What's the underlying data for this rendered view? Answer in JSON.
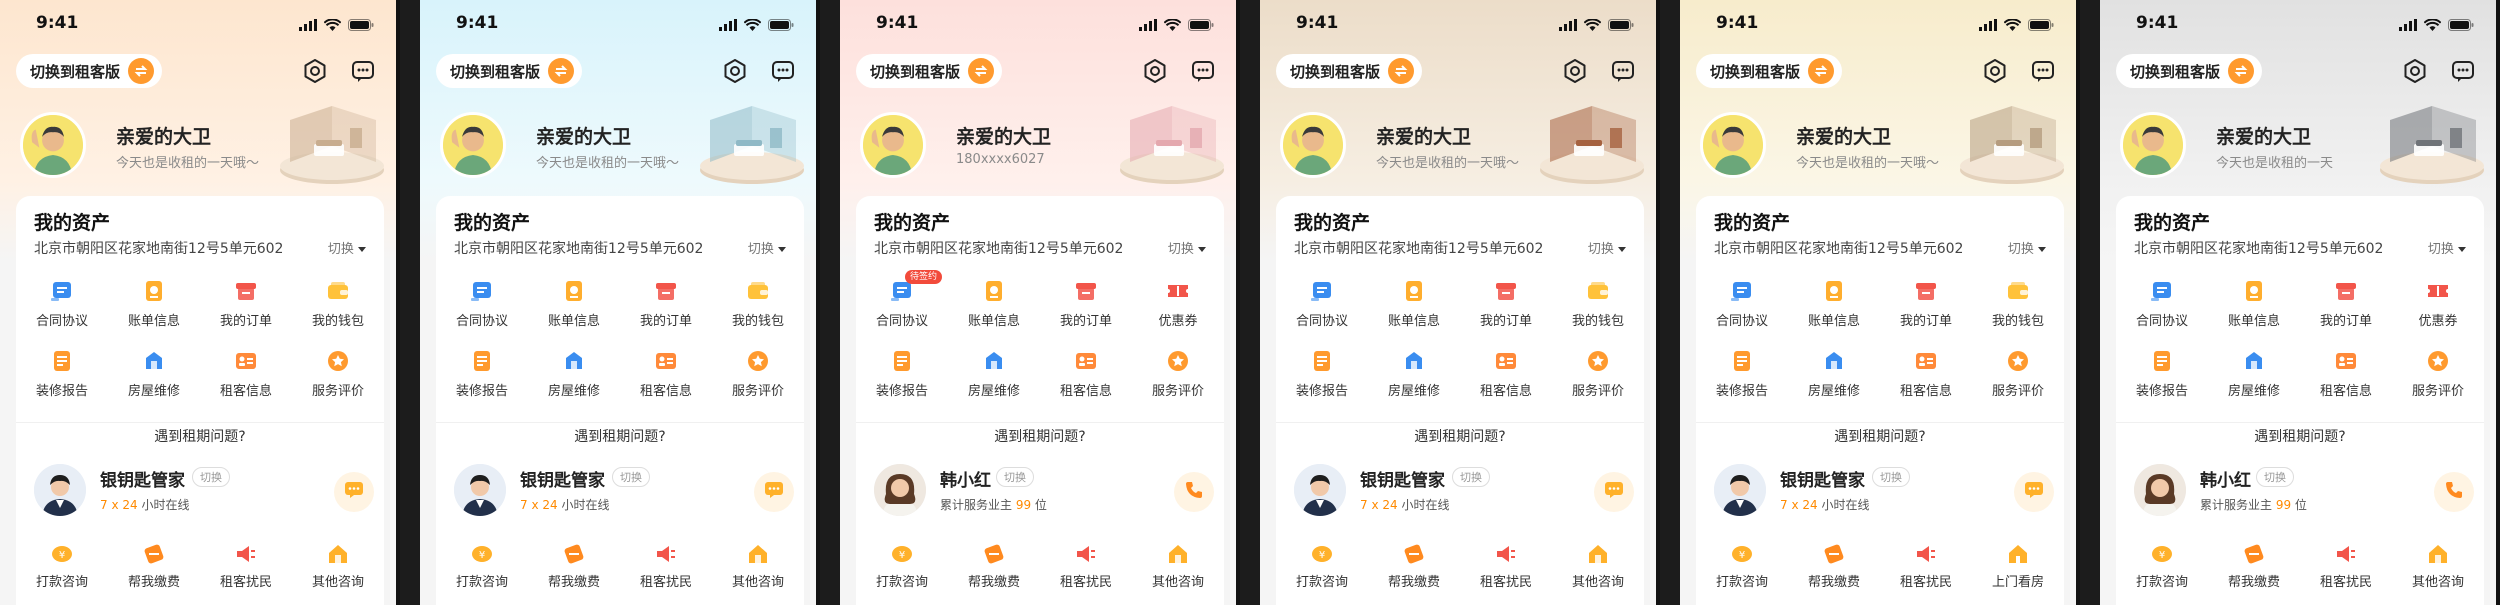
{
  "colors": {
    "accent": "#ff9a2e",
    "blue": "#3a8df0",
    "red": "#f2554a",
    "yellow": "#ffb93a"
  },
  "screens": [
    {
      "bg": [
        "#fde6cf",
        "#fff1e4"
      ],
      "room_color": "#c8ad8f",
      "status": {
        "time": "9:41"
      },
      "switch_label": "切换到租客版",
      "user": {
        "name": "亲爱的大卫",
        "subtitle": "今天也是收租的一天哦～"
      },
      "assets": {
        "title": "我的资产",
        "address": "北京市朝阳区花家地南街12号5单元602",
        "switch_label": "切换"
      },
      "grid": [
        {
          "label": "合同协议",
          "icon": "contract-icon",
          "color": "#3a8df0",
          "badge": ""
        },
        {
          "label": "账单信息",
          "icon": "bill-icon",
          "color": "#ffae2e",
          "badge": ""
        },
        {
          "label": "我的订单",
          "icon": "order-icon",
          "color": "#f2554a",
          "badge": ""
        },
        {
          "label": "我的钱包",
          "icon": "wallet-icon",
          "color": "#ffc23a",
          "badge": ""
        },
        {
          "label": "装修报告",
          "icon": "report-icon",
          "color": "#ff9a2e",
          "badge": ""
        },
        {
          "label": "房屋维修",
          "icon": "repair-icon",
          "color": "#3a8df0",
          "badge": ""
        },
        {
          "label": "租客信息",
          "icon": "tenant-info-icon",
          "color": "#ff8a3a",
          "badge": ""
        },
        {
          "label": "服务评价",
          "icon": "rating-icon",
          "color": "#ff9a2e",
          "badge": ""
        }
      ],
      "ask": "遇到租期问题?",
      "agent": {
        "name": "银钥匙管家",
        "tag": "切换",
        "hl": "7 x 24",
        "line": " 小时在线",
        "kind": "butler",
        "action": "chat"
      },
      "bottom": [
        {
          "label": "打款咨询",
          "icon": "payment-consult-icon",
          "color": "#ffb12a"
        },
        {
          "label": "帮我缴费",
          "icon": "pay-fees-icon",
          "color": "#ff8a1f"
        },
        {
          "label": "租客扰民",
          "icon": "noise-complaint-icon",
          "color": "#f2554a"
        },
        {
          "label": "其他咨询",
          "icon": "other-consult-icon",
          "color": "#ffb12a"
        }
      ]
    },
    {
      "bg": [
        "#d8f3fb",
        "#eefafd"
      ],
      "room_color": "#8fb9c6",
      "status": {
        "time": "9:41"
      },
      "switch_label": "切换到租客版",
      "user": {
        "name": "亲爱的大卫",
        "subtitle": "今天也是收租的一天哦～"
      },
      "assets": {
        "title": "我的资产",
        "address": "北京市朝阳区花家地南街12号5单元602",
        "switch_label": "切换"
      },
      "grid": [
        {
          "label": "合同协议",
          "icon": "contract-icon",
          "color": "#3a8df0",
          "badge": ""
        },
        {
          "label": "账单信息",
          "icon": "bill-icon",
          "color": "#ffae2e",
          "badge": ""
        },
        {
          "label": "我的订单",
          "icon": "order-icon",
          "color": "#f2554a",
          "badge": ""
        },
        {
          "label": "我的钱包",
          "icon": "wallet-icon",
          "color": "#ffc23a",
          "badge": ""
        },
        {
          "label": "装修报告",
          "icon": "report-icon",
          "color": "#ff9a2e",
          "badge": ""
        },
        {
          "label": "房屋维修",
          "icon": "repair-icon",
          "color": "#3a8df0",
          "badge": ""
        },
        {
          "label": "租客信息",
          "icon": "tenant-info-icon",
          "color": "#ff8a3a",
          "badge": ""
        },
        {
          "label": "服务评价",
          "icon": "rating-icon",
          "color": "#ff9a2e",
          "badge": ""
        }
      ],
      "ask": "遇到租期问题?",
      "agent": {
        "name": "银钥匙管家",
        "tag": "切换",
        "hl": "7 x 24",
        "line": " 小时在线",
        "kind": "butler",
        "action": "chat"
      },
      "bottom": [
        {
          "label": "打款咨询",
          "icon": "payment-consult-icon",
          "color": "#ffb12a"
        },
        {
          "label": "帮我缴费",
          "icon": "pay-fees-icon",
          "color": "#ff8a1f"
        },
        {
          "label": "租客扰民",
          "icon": "noise-complaint-icon",
          "color": "#f2554a"
        },
        {
          "label": "其他咨询",
          "icon": "other-consult-icon",
          "color": "#ffb12a"
        }
      ]
    },
    {
      "bg": [
        "#fde0dc",
        "#fff0ec"
      ],
      "room_color": "#e4a8ae",
      "status": {
        "time": "9:41"
      },
      "switch_label": "切换到租客版",
      "user": {
        "name": "亲爱的大卫",
        "subtitle": "180xxxx6027"
      },
      "assets": {
        "title": "我的资产",
        "address": "北京市朝阳区花家地南街12号5单元602",
        "switch_label": "切换"
      },
      "grid": [
        {
          "label": "合同协议",
          "icon": "contract-icon",
          "color": "#3a8df0",
          "badge": "待签约"
        },
        {
          "label": "账单信息",
          "icon": "bill-icon",
          "color": "#ffae2e",
          "badge": ""
        },
        {
          "label": "我的订单",
          "icon": "order-icon",
          "color": "#f2554a",
          "badge": ""
        },
        {
          "label": "优惠券",
          "icon": "coupon-icon",
          "color": "#f2554a",
          "badge": ""
        },
        {
          "label": "装修报告",
          "icon": "report-icon",
          "color": "#ff9a2e",
          "badge": ""
        },
        {
          "label": "房屋维修",
          "icon": "repair-icon",
          "color": "#3a8df0",
          "badge": ""
        },
        {
          "label": "租客信息",
          "icon": "tenant-info-icon",
          "color": "#ff8a3a",
          "badge": ""
        },
        {
          "label": "服务评价",
          "icon": "rating-icon",
          "color": "#ff9a2e",
          "badge": ""
        }
      ],
      "ask": "遇到租期问题?",
      "agent": {
        "name": "韩小红",
        "tag": "切换",
        "hl": "99",
        "line": "累计服务业主 ",
        "line2": " 位",
        "kind": "manager",
        "action": "phone"
      },
      "bottom": [
        {
          "label": "打款咨询",
          "icon": "payment-consult-icon",
          "color": "#ffb12a"
        },
        {
          "label": "帮我缴费",
          "icon": "pay-fees-icon",
          "color": "#ff8a1f"
        },
        {
          "label": "租客扰民",
          "icon": "noise-complaint-icon",
          "color": "#f2554a"
        },
        {
          "label": "其他咨询",
          "icon": "other-consult-icon",
          "color": "#ffb12a"
        }
      ]
    },
    {
      "bg": [
        "#ecddc9",
        "#f6eee2"
      ],
      "room_color": "#a5613f",
      "status": {
        "time": "9:41"
      },
      "switch_label": "切换到租客版",
      "user": {
        "name": "亲爱的大卫",
        "subtitle": "今天也是收租的一天哦～"
      },
      "assets": {
        "title": "我的资产",
        "address": "北京市朝阳区花家地南街12号5单元602",
        "switch_label": "切换"
      },
      "grid": [
        {
          "label": "合同协议",
          "icon": "contract-icon",
          "color": "#3a8df0",
          "badge": ""
        },
        {
          "label": "账单信息",
          "icon": "bill-icon",
          "color": "#ffae2e",
          "badge": ""
        },
        {
          "label": "我的订单",
          "icon": "order-icon",
          "color": "#f2554a",
          "badge": ""
        },
        {
          "label": "我的钱包",
          "icon": "wallet-icon",
          "color": "#ffc23a",
          "badge": ""
        },
        {
          "label": "装修报告",
          "icon": "report-icon",
          "color": "#ff9a2e",
          "badge": ""
        },
        {
          "label": "房屋维修",
          "icon": "repair-icon",
          "color": "#3a8df0",
          "badge": ""
        },
        {
          "label": "租客信息",
          "icon": "tenant-info-icon",
          "color": "#ff8a3a",
          "badge": ""
        },
        {
          "label": "服务评价",
          "icon": "rating-icon",
          "color": "#ff9a2e",
          "badge": ""
        }
      ],
      "ask": "遇到租期问题?",
      "agent": {
        "name": "银钥匙管家",
        "tag": "切换",
        "hl": "7 x 24",
        "line": " 小时在线",
        "kind": "butler",
        "action": "chat"
      },
      "bottom": [
        {
          "label": "打款咨询",
          "icon": "payment-consult-icon",
          "color": "#ffb12a"
        },
        {
          "label": "帮我缴费",
          "icon": "pay-fees-icon",
          "color": "#ff8a1f"
        },
        {
          "label": "租客扰民",
          "icon": "noise-complaint-icon",
          "color": "#f2554a"
        },
        {
          "label": "其他咨询",
          "icon": "other-consult-icon",
          "color": "#ffb12a"
        }
      ]
    },
    {
      "bg": [
        "#f7eccc",
        "#fbf6e6"
      ],
      "room_color": "#b59c7f",
      "status": {
        "time": "9:41"
      },
      "switch_label": "切换到租客版",
      "user": {
        "name": "亲爱的大卫",
        "subtitle": "今天也是收租的一天哦～"
      },
      "assets": {
        "title": "我的资产",
        "address": "北京市朝阳区花家地南街12号5单元602",
        "switch_label": "切换"
      },
      "grid": [
        {
          "label": "合同协议",
          "icon": "contract-icon",
          "color": "#3a8df0",
          "badge": ""
        },
        {
          "label": "账单信息",
          "icon": "bill-icon",
          "color": "#ffae2e",
          "badge": ""
        },
        {
          "label": "我的订单",
          "icon": "order-icon",
          "color": "#f2554a",
          "badge": ""
        },
        {
          "label": "我的钱包",
          "icon": "wallet-icon",
          "color": "#ffc23a",
          "badge": ""
        },
        {
          "label": "装修报告",
          "icon": "report-icon",
          "color": "#ff9a2e",
          "badge": ""
        },
        {
          "label": "房屋维修",
          "icon": "repair-icon",
          "color": "#3a8df0",
          "badge": ""
        },
        {
          "label": "租客信息",
          "icon": "tenant-info-icon",
          "color": "#ff8a3a",
          "badge": ""
        },
        {
          "label": "服务评价",
          "icon": "rating-icon",
          "color": "#ff9a2e",
          "badge": ""
        }
      ],
      "ask": "遇到租期问题?",
      "agent": {
        "name": "银钥匙管家",
        "tag": "切换",
        "hl": "7 x 24",
        "line": " 小时在线",
        "kind": "butler",
        "action": "chat"
      },
      "bottom": [
        {
          "label": "打款咨询",
          "icon": "payment-consult-icon",
          "color": "#ffb12a"
        },
        {
          "label": "帮我缴费",
          "icon": "pay-fees-icon",
          "color": "#ff8a1f"
        },
        {
          "label": "租客扰民",
          "icon": "noise-complaint-icon",
          "color": "#f2554a"
        },
        {
          "label": "上门看房",
          "icon": "home-visit-icon",
          "color": "#ffb12a"
        }
      ]
    },
    {
      "bg": [
        "#e1e1e1",
        "#f1f1f1"
      ],
      "room_color": "#6f7378",
      "status": {
        "time": "9:41"
      },
      "switch_label": "切换到租客版",
      "user": {
        "name": "亲爱的大卫",
        "subtitle": "今天也是收租的一天"
      },
      "assets": {
        "title": "我的资产",
        "address": "北京市朝阳区花家地南街12号5单元602",
        "switch_label": "切换"
      },
      "grid": [
        {
          "label": "合同协议",
          "icon": "contract-icon",
          "color": "#3a8df0",
          "badge": ""
        },
        {
          "label": "账单信息",
          "icon": "bill-icon",
          "color": "#ffae2e",
          "badge": ""
        },
        {
          "label": "我的订单",
          "icon": "order-icon",
          "color": "#f2554a",
          "badge": ""
        },
        {
          "label": "优惠券",
          "icon": "coupon-icon",
          "color": "#f2554a",
          "badge": ""
        },
        {
          "label": "装修报告",
          "icon": "report-icon",
          "color": "#ff9a2e",
          "badge": ""
        },
        {
          "label": "房屋维修",
          "icon": "repair-icon",
          "color": "#3a8df0",
          "badge": ""
        },
        {
          "label": "租客信息",
          "icon": "tenant-info-icon",
          "color": "#ff8a3a",
          "badge": ""
        },
        {
          "label": "服务评价",
          "icon": "rating-icon",
          "color": "#ff9a2e",
          "badge": ""
        }
      ],
      "ask": "遇到租期问题?",
      "agent": {
        "name": "韩小红",
        "tag": "切换",
        "hl": "99",
        "line": "累计服务业主 ",
        "line2": " 位",
        "kind": "manager",
        "action": "phone"
      },
      "bottom": [
        {
          "label": "打款咨询",
          "icon": "payment-consult-icon",
          "color": "#ffb12a"
        },
        {
          "label": "帮我缴费",
          "icon": "pay-fees-icon",
          "color": "#ff8a1f"
        },
        {
          "label": "租客扰民",
          "icon": "noise-complaint-icon",
          "color": "#f2554a"
        },
        {
          "label": "其他咨询",
          "icon": "other-consult-icon",
          "color": "#ffb12a"
        }
      ]
    }
  ]
}
